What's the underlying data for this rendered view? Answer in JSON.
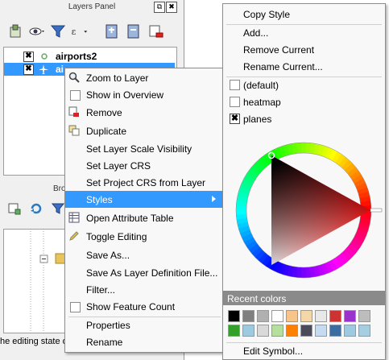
{
  "layers_panel": {
    "title": "Layers Panel",
    "float_btn": "⧉",
    "close_btn": "✖",
    "layers": [
      {
        "name": "airports2",
        "checked": "✖"
      },
      {
        "name": "ai",
        "checked": "✖"
      }
    ],
    "browser_label": "Bro",
    "status_text": "he editing state of"
  },
  "context_menu": {
    "items": [
      {
        "label": "Zoom to Layer",
        "icon": "zoom-icon"
      },
      {
        "label": "Show in Overview",
        "icon": "checkbox"
      },
      {
        "label": "Remove",
        "icon": "remove-icon"
      },
      {
        "label": "Duplicate",
        "icon": "duplicate-icon"
      },
      {
        "label": "Set Layer Scale Visibility"
      },
      {
        "label": "Set Layer CRS"
      },
      {
        "label": "Set Project CRS from Layer"
      },
      {
        "label": "Styles",
        "has_submenu": true
      },
      {
        "label": "Open Attribute Table",
        "icon": "table-icon"
      },
      {
        "label": "Toggle Editing",
        "icon": "pencil-icon"
      },
      {
        "label": "Save As..."
      },
      {
        "label": "Save As Layer Definition File..."
      },
      {
        "label": "Filter..."
      },
      {
        "label": "Show Feature Count",
        "icon": "checkbox"
      },
      {
        "label": "Properties"
      },
      {
        "label": "Rename"
      }
    ]
  },
  "styles_menu": {
    "copy_style": "Copy Style",
    "add": "Add...",
    "remove_current": "Remove Current",
    "rename_current": "Rename Current...",
    "styles": [
      {
        "label": "(default)",
        "checked": ""
      },
      {
        "label": "heatmap",
        "checked": ""
      },
      {
        "label": "planes",
        "checked": "✖"
      }
    ],
    "recent_colors_label": "Recent colors",
    "recent_colors_row1": [
      "#000000",
      "#808080",
      "#b0b0b0",
      "#ffffff",
      "#f7c58a",
      "#f4d7a8",
      "#e8e8e8",
      "#cc3333",
      "#9933cc",
      "#bdbdbd"
    ],
    "recent_colors_row2": [
      "#33a02c",
      "#9ecae1",
      "#d9d9d9",
      "#b5df9c",
      "#ff7f00",
      "#4a4a5a",
      "#c6dbef",
      "#3d6d9e",
      "#9ecae1",
      "#a6cee3"
    ],
    "edit_symbol": "Edit Symbol..."
  },
  "colors": {
    "selection": "#3399ff",
    "wheel_hue_current": "#ff0000"
  }
}
